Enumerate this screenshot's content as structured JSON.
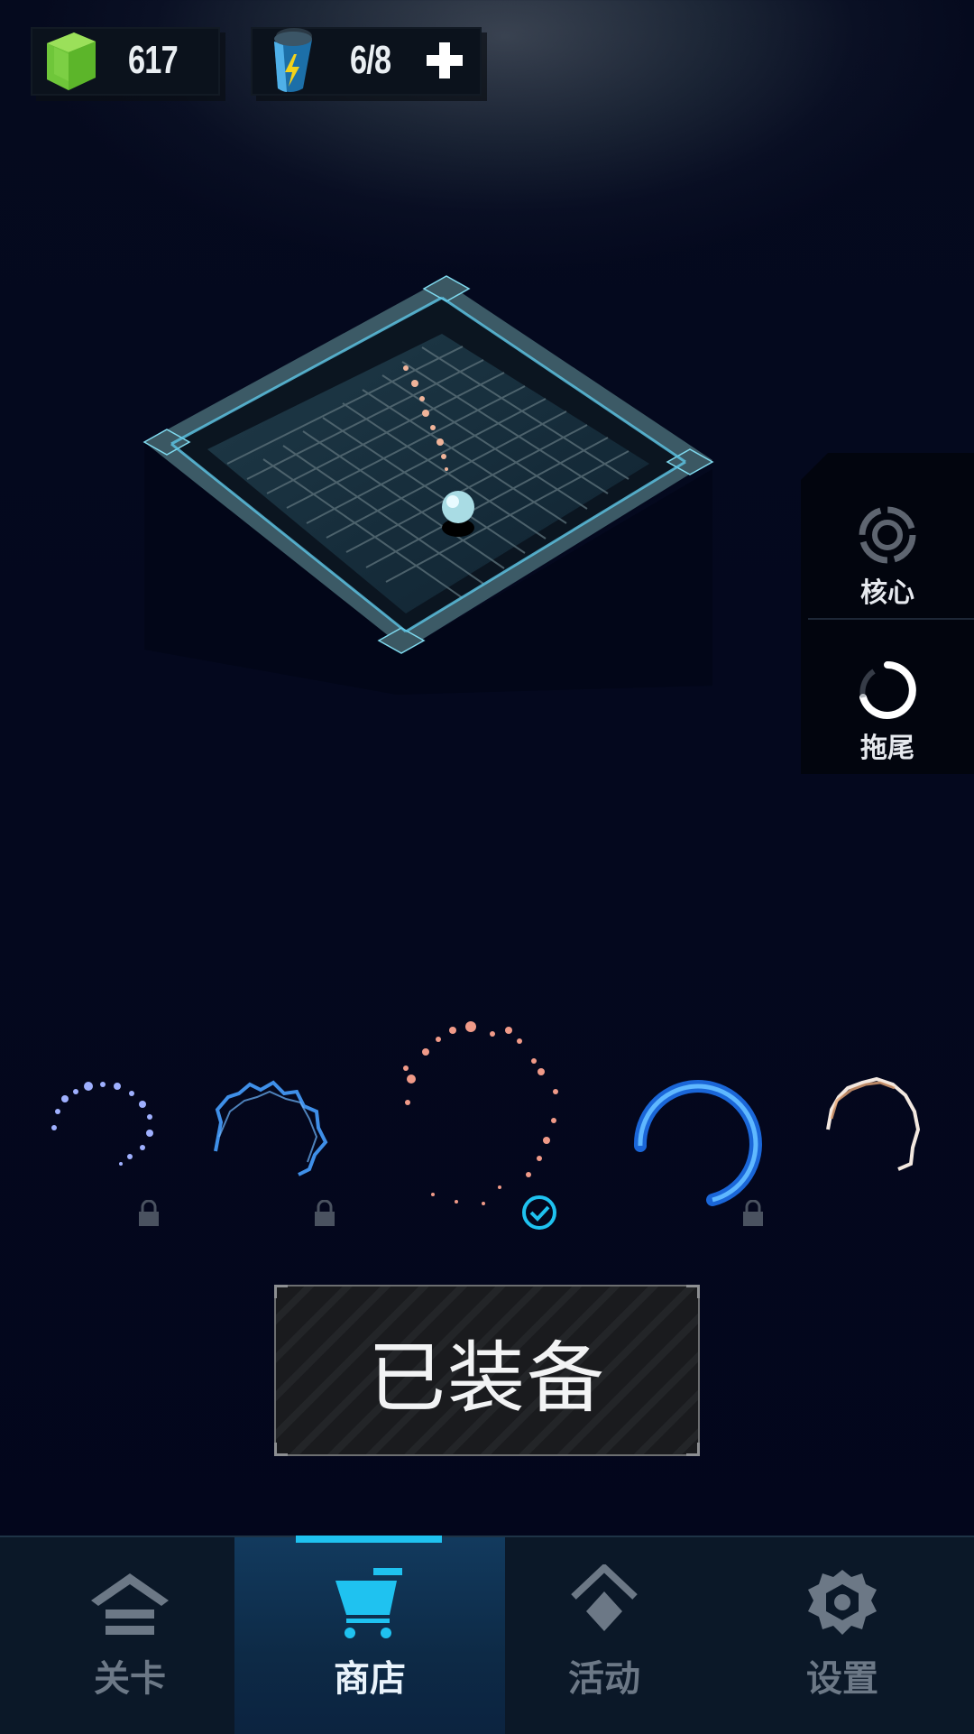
{
  "resources": {
    "gems": {
      "value": "617",
      "icon": "green-gem-icon"
    },
    "energy": {
      "value": "6/8",
      "icon": "energy-battery-icon",
      "add_icon": "plus-icon"
    }
  },
  "side_panel": {
    "items": [
      {
        "label": "核心",
        "icon": "core-ring-icon"
      },
      {
        "label": "拖尾",
        "icon": "trail-ring-icon"
      }
    ]
  },
  "trails": [
    {
      "style": "sparkle-blue",
      "locked": true,
      "equipped": false
    },
    {
      "style": "lightning-blue",
      "locked": true,
      "equipped": false
    },
    {
      "style": "ember-orange",
      "locked": false,
      "equipped": true
    },
    {
      "style": "neon-ring-blue",
      "locked": true,
      "equipped": false
    },
    {
      "style": "flame-white",
      "locked": false,
      "equipped": false
    }
  ],
  "equip_button": {
    "label": "已装备"
  },
  "nav": {
    "tabs": [
      {
        "label": "关卡",
        "icon": "level-home-icon",
        "active": false
      },
      {
        "label": "商店",
        "icon": "shop-cart-icon",
        "active": true
      },
      {
        "label": "活动",
        "icon": "activity-diamond-icon",
        "active": false
      },
      {
        "label": "设置",
        "icon": "settings-gear-icon",
        "active": false
      }
    ]
  },
  "colors": {
    "accent": "#1fc2f0",
    "gem": "#6fc63a",
    "background": "#040a1e"
  }
}
